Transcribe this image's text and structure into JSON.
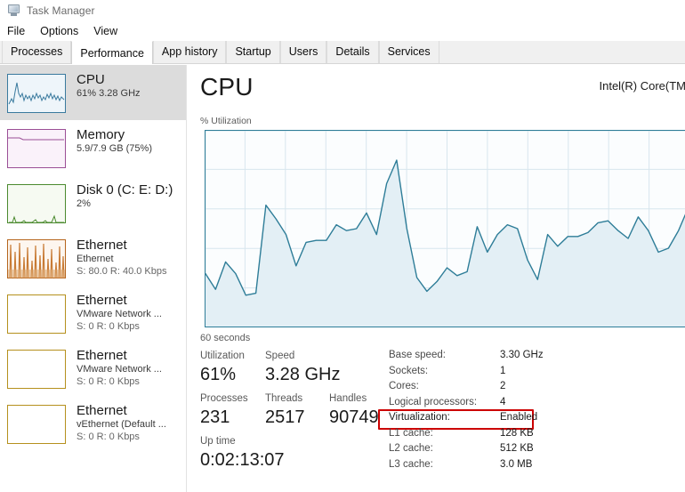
{
  "window": {
    "title": "Task Manager",
    "icon": "task-manager-icon"
  },
  "menu": {
    "items": [
      {
        "label": "File"
      },
      {
        "label": "Options"
      },
      {
        "label": "View"
      }
    ]
  },
  "tabs": {
    "selected": "Performance",
    "items": [
      {
        "label": "Processes",
        "selected": false
      },
      {
        "label": "Performance",
        "selected": true
      },
      {
        "label": "App history",
        "selected": false
      },
      {
        "label": "Startup",
        "selected": false
      },
      {
        "label": "Users",
        "selected": false
      },
      {
        "label": "Details",
        "selected": false
      },
      {
        "label": "Services",
        "selected": false
      }
    ]
  },
  "sidebar": {
    "items": [
      {
        "title": "CPU",
        "sub1": "61%  3.28 GHz",
        "sub2": "",
        "selected": true,
        "accent": "#3a7a9e",
        "thumb": "cpu-sparkline"
      },
      {
        "title": "Memory",
        "sub1": "5.9/7.9 GB (75%)",
        "sub2": "",
        "selected": false,
        "accent": "#9b4f96",
        "thumb": "memory-sparkline"
      },
      {
        "title": "Disk 0 (C: E: D:)",
        "sub1": "2%",
        "sub2": "",
        "selected": false,
        "accent": "#4b8a2f",
        "thumb": "disk-sparkline"
      },
      {
        "title": "Ethernet",
        "sub1": "Ethernet",
        "sub2": "S: 80.0 R: 40.0 Kbps",
        "selected": false,
        "accent": "#b5651d",
        "thumb": "ethernet-sparkline-active"
      },
      {
        "title": "Ethernet",
        "sub1": "VMware Network ...",
        "sub2": "S: 0 R: 0 Kbps",
        "selected": false,
        "accent": "#b5901d",
        "thumb": "ethernet-sparkline-idle"
      },
      {
        "title": "Ethernet",
        "sub1": "VMware Network ...",
        "sub2": "S: 0 R: 0 Kbps",
        "selected": false,
        "accent": "#b5901d",
        "thumb": "ethernet-sparkline-idle"
      },
      {
        "title": "Ethernet",
        "sub1": "vEthernet (Default ...",
        "sub2": "S: 0 R: 0 Kbps",
        "selected": false,
        "accent": "#b5901d",
        "thumb": "ethernet-sparkline-idle"
      }
    ]
  },
  "detail": {
    "title": "CPU",
    "model": "Intel(R) Core(TM",
    "axis_label": "% Utilization",
    "time_label": "60 seconds",
    "stats_left": [
      {
        "label": "Utilization",
        "value": "61%"
      },
      {
        "label": "Speed",
        "value": "3.28 GHz"
      },
      {
        "label": "Processes",
        "value": "231"
      },
      {
        "label": "Threads",
        "value": "2517"
      },
      {
        "label": "Handles",
        "value": "90749"
      },
      {
        "label": "Up time",
        "value": "0:02:13:07"
      }
    ],
    "stats_right": [
      {
        "key": "Base speed:",
        "value": "3.30 GHz",
        "highlight": false
      },
      {
        "key": "Sockets:",
        "value": "1",
        "highlight": false
      },
      {
        "key": "Cores:",
        "value": "2",
        "highlight": false
      },
      {
        "key": "Logical processors:",
        "value": "4",
        "highlight": false
      },
      {
        "key": "Virtualization:",
        "value": "Enabled",
        "highlight": true
      },
      {
        "key": "L1 cache:",
        "value": "128 KB",
        "highlight": false
      },
      {
        "key": "L2 cache:",
        "value": "512 KB",
        "highlight": false
      },
      {
        "key": "L3 cache:",
        "value": "3.0 MB",
        "highlight": false
      }
    ]
  },
  "colors": {
    "chart_line": "#2e7d98",
    "chart_fill": "#e3eff5",
    "chart_border": "#2e7d98",
    "grid": "#d8e6ee",
    "highlight_box": "#cc0000",
    "selection": "#dcdcdc"
  },
  "chart_data": {
    "type": "area",
    "title": "CPU % Utilization",
    "xlabel": "60 seconds",
    "ylabel": "% Utilization",
    "ylim": [
      0,
      100
    ],
    "xlim": [
      0,
      60
    ],
    "grid": true,
    "legend": false,
    "series": [
      {
        "name": "CPU Utilization",
        "values": [
          27,
          19,
          33,
          27,
          16,
          17,
          62,
          55,
          47,
          31,
          43,
          44,
          44,
          52,
          49,
          50,
          58,
          47,
          73,
          85,
          50,
          25,
          18,
          23,
          30,
          26,
          28,
          51,
          38,
          47,
          52,
          50,
          34,
          24,
          47,
          41,
          46,
          46,
          48,
          53,
          54,
          49,
          45,
          56,
          49,
          38,
          40,
          49,
          61
        ]
      }
    ]
  }
}
